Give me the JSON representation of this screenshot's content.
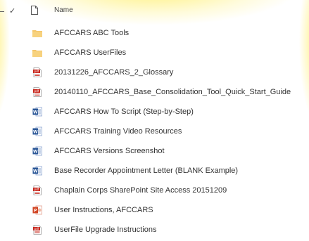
{
  "header": {
    "name_label": "Name"
  },
  "files": [
    {
      "name": "AFCCARS ABC Tools",
      "icon": "folder-icon"
    },
    {
      "name": "AFCCARS UserFiles",
      "icon": "folder-icon"
    },
    {
      "name": "20131226_AFCCARS_2_Glossary",
      "icon": "pdf-icon"
    },
    {
      "name": "20140110_AFCCARS_Base_Consolidation_Tool_Quick_Start_Guide",
      "icon": "pdf-icon"
    },
    {
      "name": "AFCCARS How To Script (Step-by-Step)",
      "icon": "word-icon"
    },
    {
      "name": "AFCCARS Training Video Resources",
      "icon": "word-icon"
    },
    {
      "name": "AFCCARS Versions Screenshot",
      "icon": "word-icon"
    },
    {
      "name": "Base Recorder Appointment Letter (BLANK Example)",
      "icon": "word-icon"
    },
    {
      "name": "Chaplain Corps SharePoint Site Access 20151209",
      "icon": "pdf-icon"
    },
    {
      "name": "User Instructions, AFCCARS",
      "icon": "powerpoint-icon"
    },
    {
      "name": "UserFile Upgrade Instructions",
      "icon": "pdf-icon"
    }
  ],
  "colors": {
    "folder": "#F4C66A",
    "pdf": "#C8281E",
    "word": "#2B5797",
    "powerpoint": "#D24726"
  }
}
